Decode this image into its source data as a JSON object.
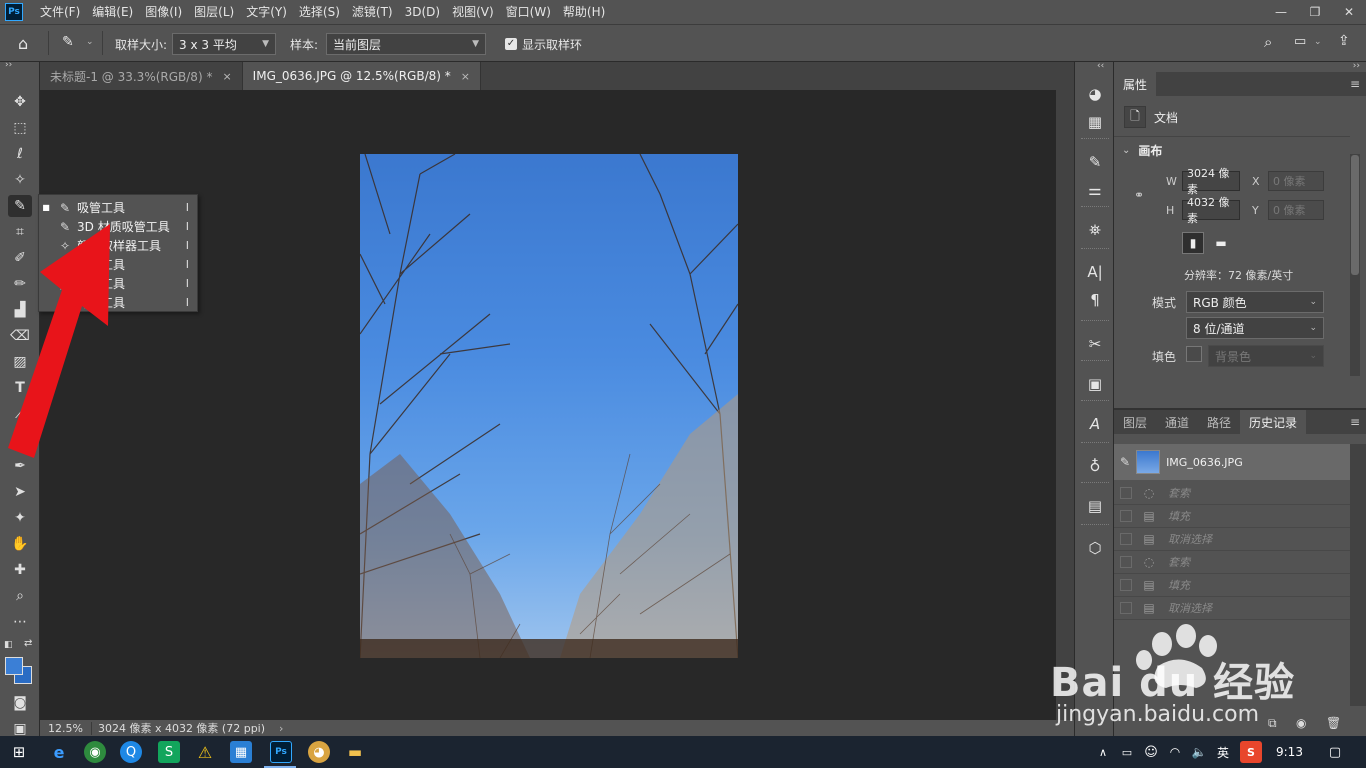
{
  "app": {
    "logo": "Ps"
  },
  "menubar": {
    "items": [
      "文件(F)",
      "编辑(E)",
      "图像(I)",
      "图层(L)",
      "文字(Y)",
      "选择(S)",
      "滤镜(T)",
      "3D(D)",
      "视图(V)",
      "窗口(W)",
      "帮助(H)"
    ],
    "window_controls": [
      "—",
      "❐",
      "✕"
    ]
  },
  "options": {
    "sample_size_label": "取样大小:",
    "sample_size_value": "3 x 3 平均",
    "sample_label": "样本:",
    "sample_value": "当前图层",
    "show_ring_label": "显示取样环",
    "show_ring_checked": true
  },
  "tabs": [
    {
      "label": "未标题-1 @ 33.3%(RGB/8) *",
      "active": false
    },
    {
      "label": "IMG_0636.JPG @ 12.5%(RGB/8) *",
      "active": true
    }
  ],
  "tab_close_glyph": "×",
  "flyout": {
    "items": [
      {
        "label": "吸管工具",
        "key": "I",
        "selected": true
      },
      {
        "label": "3D 材质吸管工具",
        "key": "I",
        "selected": false
      },
      {
        "label": "颜色取样器工具",
        "key": "I",
        "selected": false
      },
      {
        "label": "标尺工具",
        "key": "I",
        "selected": false
      },
      {
        "label": "注释工具",
        "key": "I",
        "selected": false
      },
      {
        "label": "计数工具",
        "key": "I",
        "selected": false
      }
    ]
  },
  "status": {
    "zoom": "12.5%",
    "doc_info": "3024 像素 x 4032 像素 (72 ppi)"
  },
  "properties": {
    "tab": "属性",
    "doc_label": "文档",
    "canvas_section": "画布",
    "w_label": "W",
    "w_value": "3024 像素",
    "h_label": "H",
    "h_value": "4032 像素",
    "x_label": "X",
    "x_placeholder": "0 像素",
    "y_label": "Y",
    "y_placeholder": "0 像素",
    "resolution": "分辨率：72 像素/英寸",
    "mode_label": "模式",
    "mode_value": "RGB 颜色",
    "depth_value": "8 位/通道",
    "fill_label": "填色",
    "fill_value": "背景色"
  },
  "history": {
    "tabs": [
      "图层",
      "通道",
      "路径",
      "历史记录"
    ],
    "active_tab": "历史记录",
    "snapshot": "IMG_0636.JPG",
    "steps": [
      {
        "label": "套索",
        "icon": "lasso-icon"
      },
      {
        "label": "填充",
        "icon": "step-icon"
      },
      {
        "label": "取消选择",
        "icon": "step-icon"
      },
      {
        "label": "套索",
        "icon": "lasso-icon"
      },
      {
        "label": "填充",
        "icon": "step-icon"
      },
      {
        "label": "取消选择",
        "icon": "step-icon"
      }
    ]
  },
  "taskbar": {
    "ime": "英",
    "time": "9:13"
  },
  "watermark": {
    "brand": "Bai du 经验",
    "url": "jingyan.baidu.com"
  },
  "colors": {
    "accent_red": "#e8141a",
    "sky_blue": "#3b78cf",
    "panel_bg": "#535353"
  }
}
